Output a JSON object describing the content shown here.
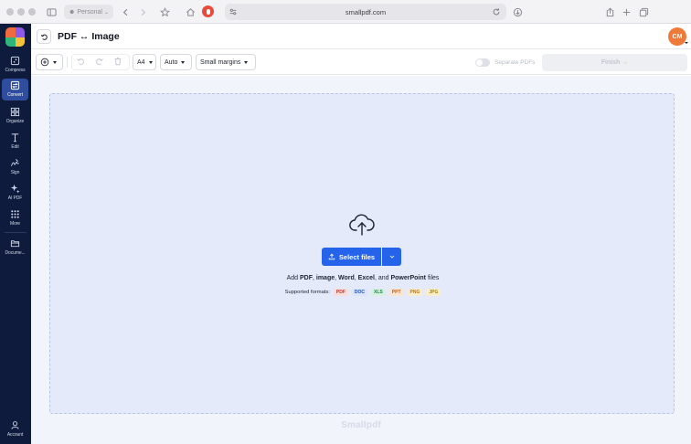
{
  "browser": {
    "profile_label": "Personal",
    "url": "smallpdf.com"
  },
  "sidebar": {
    "items": [
      {
        "label": "Compress",
        "icon": "compress-icon"
      },
      {
        "label": "Convert",
        "icon": "convert-icon",
        "active": true
      },
      {
        "label": "Organize",
        "icon": "organize-icon"
      },
      {
        "label": "Edit",
        "icon": "edit-icon"
      },
      {
        "label": "Sign",
        "icon": "sign-icon"
      },
      {
        "label": "AI PDF",
        "icon": "ai-sparkle-icon"
      },
      {
        "label": "More",
        "icon": "more-grid-icon"
      },
      {
        "label": "Docume...",
        "icon": "folder-icon"
      }
    ],
    "account_label": "Account"
  },
  "header": {
    "title": "PDF ↔ Image",
    "avatar_initials": "CM",
    "avatar_color": "#ee7a3a"
  },
  "toolbar": {
    "page_size": "A4",
    "orientation": "Auto",
    "margins": "Small margins",
    "separate_label": "Separate PDFs",
    "finish_label": "Finish →"
  },
  "dropzone": {
    "select_label": "Select files",
    "line_prefix": "Add ",
    "fmt_pdf": "PDF",
    "sep1": ", ",
    "fmt_image": "image",
    "sep2": ", ",
    "fmt_word": "Word",
    "sep3": ", ",
    "fmt_excel": "Excel",
    "sep4": ", and ",
    "fmt_ppt": "PowerPoint",
    "line_suffix": " files",
    "supported_label": "Supported formats:",
    "badges": [
      {
        "label": "PDF",
        "color": "#c0392b",
        "bg": "#fbdedb"
      },
      {
        "label": "DOC",
        "color": "#1f4fb4",
        "bg": "#dbe5fb"
      },
      {
        "label": "XLS",
        "color": "#1c8a4b",
        "bg": "#d7f1e1"
      },
      {
        "label": "PPT",
        "color": "#c2611b",
        "bg": "#fbe4d2"
      },
      {
        "label": "PNG",
        "color": "#b0791d",
        "bg": "#fbecd0"
      },
      {
        "label": "JPG",
        "color": "#a88412",
        "bg": "#f8efc9"
      }
    ]
  },
  "footer": {
    "brand": "Smallpdf"
  },
  "colors": {
    "sidebar_bg": "#0e1b3d",
    "accent": "#2563eb"
  }
}
